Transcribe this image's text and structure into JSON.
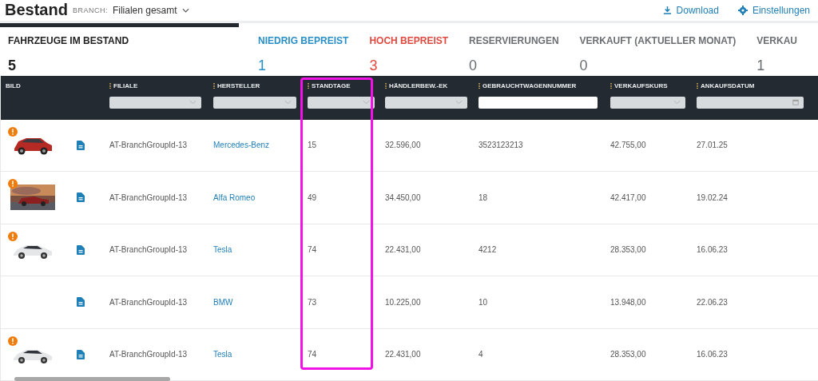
{
  "header": {
    "title": "Bestand",
    "branch_label": "BRANCH:",
    "branch_value": "Filialen gesamt",
    "actions": [
      "Download",
      "Einstellungen"
    ]
  },
  "stats": [
    {
      "label": "FAHRZEUGE IM BESTAND",
      "value": "5",
      "color": "#222222",
      "selected": true
    },
    {
      "label": "NIEDRIG BEPREIST",
      "value": "1",
      "color": "#2a8fc4",
      "selected": false
    },
    {
      "label": "HOCH BEPREIST",
      "value": "3",
      "color": "#e0493f",
      "selected": false
    },
    {
      "label": "RESERVIERUNGEN",
      "value": "0",
      "color": "#6b6f73",
      "selected": false
    },
    {
      "label": "VERKAUFT (AKTUELLER MONAT)",
      "value": "0",
      "color": "#6b6f73",
      "selected": false
    },
    {
      "label": "VERKAU",
      "value": "1",
      "color": "#6b6f73",
      "selected": false
    }
  ],
  "columns": [
    {
      "label": "BILD",
      "kind": "plain",
      "highlighted": false
    },
    {
      "kind": "plain",
      "highlighted": false
    },
    {
      "label": "FILIALE",
      "kind": "select",
      "highlighted": false
    },
    {
      "label": "HERSTELLER",
      "kind": "select",
      "highlighted": false
    },
    {
      "label": "STANDTAGE",
      "kind": "select",
      "highlighted": true
    },
    {
      "label": "HÄNDLERBEW.-EK",
      "kind": "select",
      "highlighted": false
    },
    {
      "label": "GEBRAUCHTWAGENNUMMER",
      "kind": "text",
      "highlighted": false
    },
    {
      "label": "VERKAUFSKURS",
      "kind": "select",
      "highlighted": false
    },
    {
      "label": "ANKAUFSDATUM",
      "kind": "date",
      "highlighted": false
    }
  ],
  "rows": [
    {
      "kind": "picture",
      "warning": true,
      "branch": "AT-BranchGroupId-13",
      "maker": "Mercedes-Benz",
      "days": "15",
      "dealer_ek": "32.596,00",
      "number": "3523123213",
      "price": "42.755,00",
      "date": "27.01.25"
    },
    {
      "kind": "picture",
      "warning": true,
      "branch": "AT-BranchGroupId-13",
      "maker": "Alfa Romeo",
      "days": "49",
      "dealer_ek": "34.450,00",
      "number": "18",
      "price": "42.417,00",
      "date": "19.02.24"
    },
    {
      "kind": "picture",
      "warning": true,
      "branch": "AT-BranchGroupId-13",
      "maker": "Tesla",
      "days": "74",
      "dealer_ek": "22.431,00",
      "number": "4212",
      "price": "28.353,00",
      "date": "16.06.23"
    },
    {
      "kind": "plain",
      "warning": false,
      "branch": "AT-BranchGroupId-13",
      "maker": "BMW",
      "days": "73",
      "dealer_ek": "10.225,00",
      "number": "10",
      "price": "13.948,00",
      "date": "22.06.23"
    },
    {
      "kind": "picture",
      "warning": true,
      "branch": "AT-BranchGroupId-13",
      "maker": "Tesla",
      "days": "74",
      "dealer_ek": "22.431,00",
      "number": "4",
      "price": "28.353,00",
      "date": "16.06.23"
    }
  ]
}
